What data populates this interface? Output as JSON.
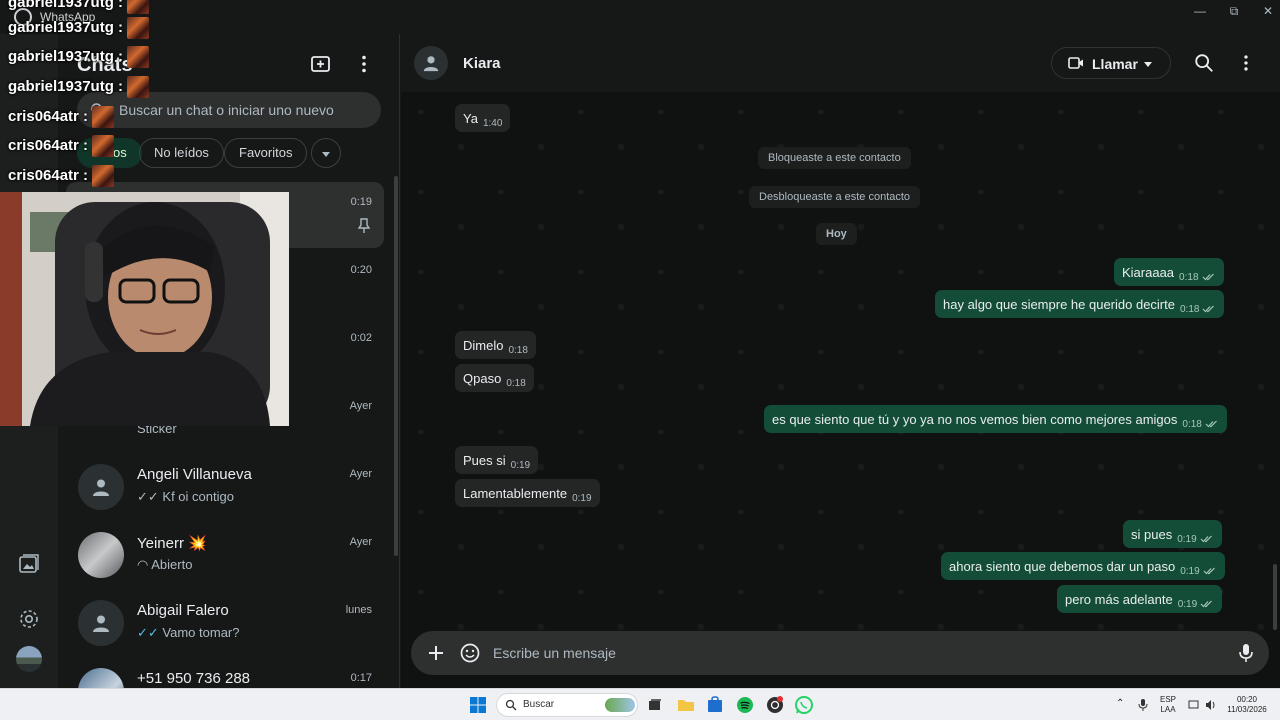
{
  "window": {
    "app_title": "WhatsApp"
  },
  "sidebar": {
    "title": "Chats",
    "search_placeholder": "Buscar un chat o iniciar uno nuevo",
    "filters": [
      "Todos",
      "No leídos",
      "Favoritos"
    ],
    "chats": [
      {
        "name": "",
        "preview": "",
        "time": "0:19",
        "pinned": true,
        "active": true
      },
      {
        "name": "",
        "preview": "",
        "time": "0:20"
      },
      {
        "name": "",
        "preview": "",
        "time": "0:02"
      },
      {
        "name": "",
        "preview": "Sticker",
        "time": "Ayer"
      },
      {
        "name": "Angeli Villanueva",
        "preview": "Kf oi contigo",
        "time": "Ayer"
      },
      {
        "name": "Yeinerr 💥",
        "preview": "Abierto",
        "time": "Ayer"
      },
      {
        "name": "Abigail Falero",
        "preview": "Vamo tomar?",
        "time": "lunes"
      },
      {
        "name": "+51 950 736 288",
        "preview": "",
        "time": "0:17"
      }
    ]
  },
  "conversation": {
    "contact_name": "Kiara",
    "call_label": "Llamar",
    "system_notes": [
      "Bloqueaste a este contacto",
      "Desbloqueaste a este contacto"
    ],
    "day_label": "Hoy",
    "messages": [
      {
        "dir": "in",
        "text": "Ya",
        "time": "1:40"
      },
      {
        "dir": "out",
        "text": "Kiaraaaa",
        "time": "0:18"
      },
      {
        "dir": "out",
        "text": "hay algo que siempre he querido decirte",
        "time": "0:18"
      },
      {
        "dir": "in",
        "text": "Dimelo",
        "time": "0:18"
      },
      {
        "dir": "in",
        "text": "Qpaso",
        "time": "0:18"
      },
      {
        "dir": "out",
        "text": "es que siento que tú y yo ya no nos vemos bien como mejores amigos",
        "time": "0:18"
      },
      {
        "dir": "in",
        "text": "Pues si",
        "time": "0:19"
      },
      {
        "dir": "in",
        "text": "Lamentablemente",
        "time": "0:19"
      },
      {
        "dir": "out",
        "text": "si pues",
        "time": "0:19"
      },
      {
        "dir": "out",
        "text": "ahora siento que debemos dar un paso",
        "time": "0:19"
      },
      {
        "dir": "out",
        "text": "pero más adelante",
        "time": "0:19"
      }
    ],
    "composer_placeholder": "Escribe un mensaje"
  },
  "stream_overlay": {
    "chat_lines": [
      "gabriel1937utg :",
      "gabriel1937utg :",
      "gabriel1937utg :",
      "gabriel1937utg :",
      "cris064atr :",
      "cris064atr :",
      "cris064atr :"
    ]
  },
  "taskbar": {
    "search_label": "Buscar",
    "language": "ESP",
    "layout": "LAA",
    "clock_time": "00:20",
    "clock_date": "11/03/2026"
  },
  "colors": {
    "accent_green": "#144d37",
    "read_tick": "#53bdeb",
    "background": "#161717"
  }
}
